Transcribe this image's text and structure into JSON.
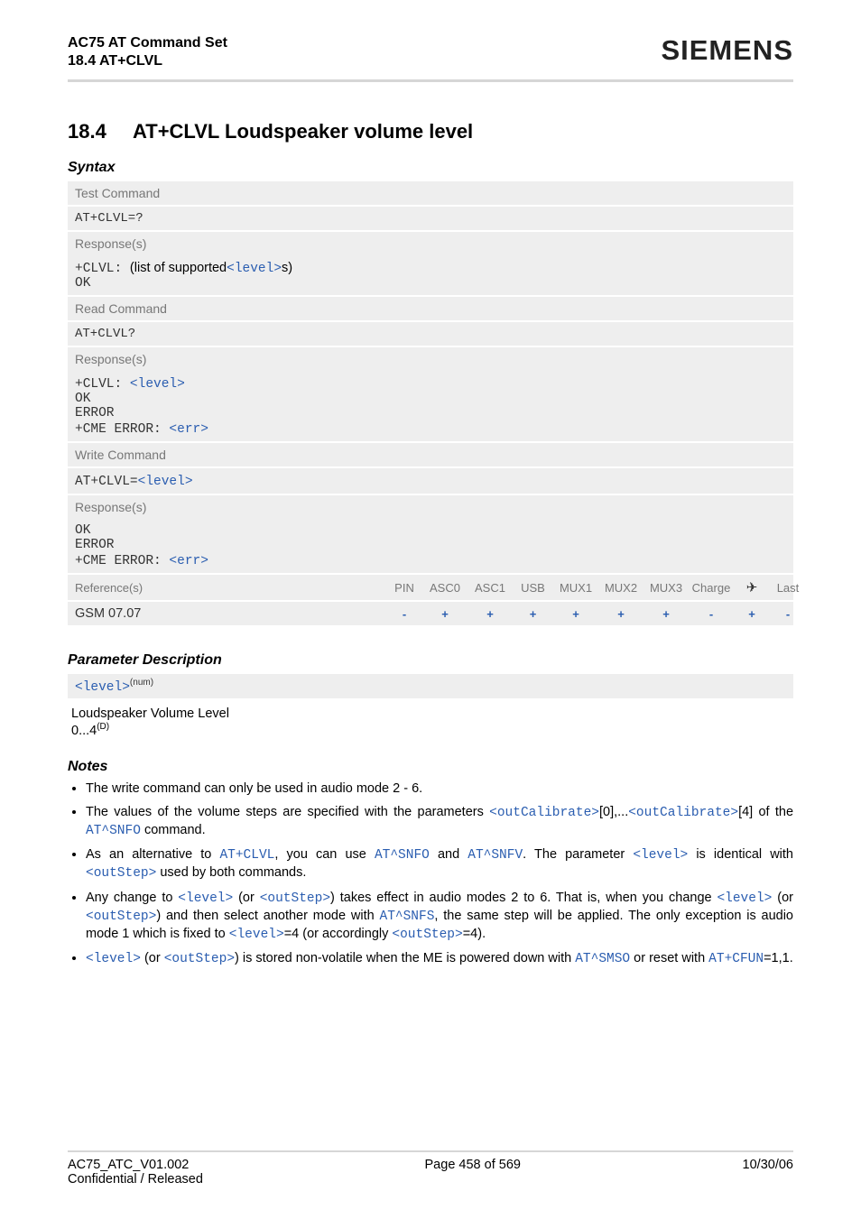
{
  "header": {
    "title_line1": "AC75 AT Command Set",
    "title_line2": "18.4 AT+CLVL",
    "brand": "SIEMENS"
  },
  "section": {
    "number": "18.4",
    "title": "AT+CLVL   Loudspeaker volume level"
  },
  "syntax_label": "Syntax",
  "test_block": {
    "label": "Test Command",
    "cmd": "AT+CLVL=?",
    "resp_label": "Response(s)",
    "resp_prefix": "+CLVL: ",
    "resp_text": "(list of supported",
    "resp_param": "<level>",
    "resp_suffix": "s)",
    "ok": "OK"
  },
  "read_block": {
    "label": "Read Command",
    "cmd": "AT+CLVL?",
    "resp_label": "Response(s)",
    "resp_prefix": "+CLVL: ",
    "resp_param": "<level>",
    "ok": "OK",
    "error": "ERROR",
    "cme_prefix": "+CME ERROR: ",
    "cme_param": "<err>"
  },
  "write_block": {
    "label": "Write Command",
    "cmd_prefix": "AT+CLVL=",
    "cmd_param": "<level>",
    "resp_label": "Response(s)",
    "ok": "OK",
    "error": "ERROR",
    "cme_prefix": "+CME ERROR: ",
    "cme_param": "<err>"
  },
  "ref_row": {
    "left_label": "Reference(s)",
    "cols": [
      "PIN",
      "ASC0",
      "ASC1",
      "USB",
      "MUX1",
      "MUX2",
      "MUX3",
      "Charge",
      "",
      "Last"
    ],
    "left_value": "GSM 07.07",
    "vals": [
      "-",
      "+",
      "+",
      "+",
      "+",
      "+",
      "+",
      "-",
      "+",
      "-"
    ]
  },
  "param_desc_label": "Parameter Description",
  "param_box": {
    "name": "<level>",
    "sup": "(num)"
  },
  "param_body": {
    "line1": "Loudspeaker Volume Level",
    "range_a": "0...4",
    "range_sup": "(D)"
  },
  "notes_label": "Notes",
  "notes": {
    "n1": "The write command can only be used in audio mode 2 - 6.",
    "n2_a": "The values of the volume steps are specified with the parameters ",
    "n2_b": "<outCalibrate>",
    "n2_c": "[0],...",
    "n2_d": "<outCalibrate>",
    "n2_e": "[4] of the ",
    "n2_f": "AT^SNFO",
    "n2_g": " command.",
    "n3_a": "As an alternative to ",
    "n3_b": "AT+CLVL",
    "n3_c": ", you can use ",
    "n3_d": "AT^SNFO",
    "n3_e": " and ",
    "n3_f": "AT^SNFV",
    "n3_g": ". The parameter ",
    "n3_h": "<level>",
    "n3_i": " is identical with ",
    "n3_j": "<outStep>",
    "n3_k": " used by both commands.",
    "n4_a": "Any change to ",
    "n4_b": "<level>",
    "n4_c": " (or ",
    "n4_d": "<outStep>",
    "n4_e": ") takes effect in audio modes 2 to 6. That is, when you change ",
    "n4_f": "<level>",
    "n4_g": " (or ",
    "n4_h": "<outStep>",
    "n4_i": ") and then select another mode with ",
    "n4_j": "AT^SNFS",
    "n4_k": ", the same step will be applied. The only exception is audio mode 1 which is fixed to ",
    "n4_l": "<level>",
    "n4_m": "=4 (or accordingly ",
    "n4_n": "<outStep>",
    "n4_o": "=4).",
    "n5_a": "<level>",
    "n5_b": " (or ",
    "n5_c": "<outStep>",
    "n5_d": ") is stored non-volatile when the ME is powered down with ",
    "n5_e": "AT^SMSO",
    "n5_f": " or reset with ",
    "n5_g": "AT+CFUN",
    "n5_h": "=1,1."
  },
  "footer": {
    "left": "AC75_ATC_V01.002",
    "left2": "Confidential / Released",
    "center": "Page 458 of 569",
    "right": "10/30/06"
  }
}
